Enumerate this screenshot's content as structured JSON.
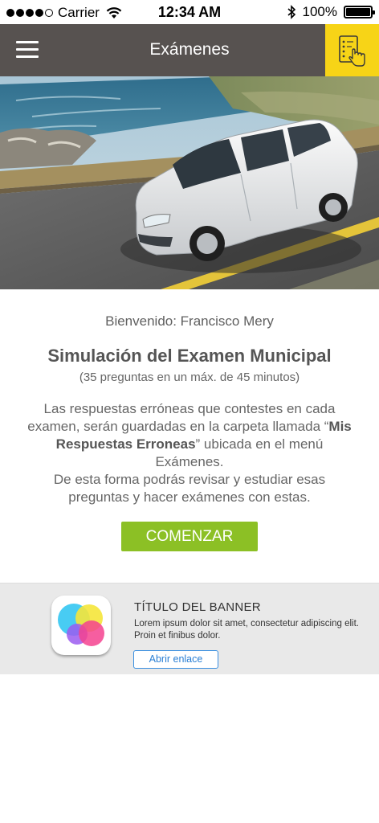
{
  "status_bar": {
    "carrier": "Carrier",
    "time": "12:34 AM",
    "battery": "100%"
  },
  "nav": {
    "title": "Exámenes"
  },
  "content": {
    "welcome": "Bienvenido: Francisco Mery",
    "title": "Simulación del Examen Municipal",
    "subtitle": "(35 preguntas en un máx. de 45 minutos)",
    "description_1": "Las respuestas erróneas que contestes en cada examen, serán guardadas en la carpeta llamada “",
    "description_bold": "Mis Respuestas Erroneas",
    "description_2": "” ubicada en el menú Exámenes.",
    "description_3": "De esta forma podrás revisar y estudiar esas preguntas y hacer exámenes con estas.",
    "start_button": "COMENZAR"
  },
  "banner": {
    "title": "TÍTULO DEL BANNER",
    "text": "Lorem ipsum dolor sit amet, consectetur adipiscing elit. Proin et finibus dolor.",
    "link": "Abrir enlace"
  },
  "colors": {
    "nav_bg": "#575250",
    "accent_yellow": "#f7d417",
    "start_green": "#8cc025",
    "banner_bg": "#e9e9e9",
    "link_blue": "#2a7fd4"
  },
  "icons": {
    "menu": "hamburger-menu-icon",
    "exam": "checklist-hand-icon",
    "wifi": "wifi-icon",
    "bluetooth": "bluetooth-icon",
    "battery": "battery-icon",
    "app": "game-center-bubbles-icon"
  }
}
